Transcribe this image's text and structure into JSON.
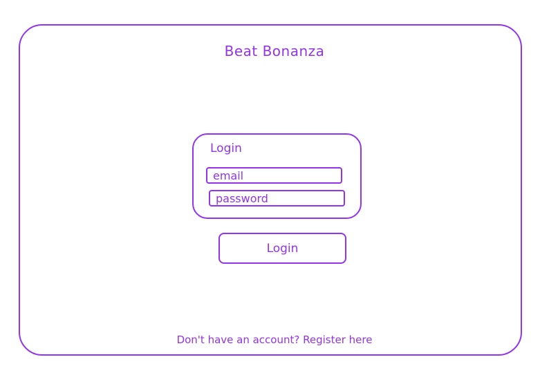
{
  "app": {
    "title": "Beat Bonanza"
  },
  "login_card": {
    "title": "Login",
    "email": {
      "value": "",
      "placeholder": "email"
    },
    "password": {
      "value": "",
      "placeholder": "password"
    }
  },
  "actions": {
    "login_label": "Login",
    "register_link": "Don't have an account? Register here"
  },
  "colors": {
    "accent": "#9333ea",
    "background": "#ffffff"
  }
}
